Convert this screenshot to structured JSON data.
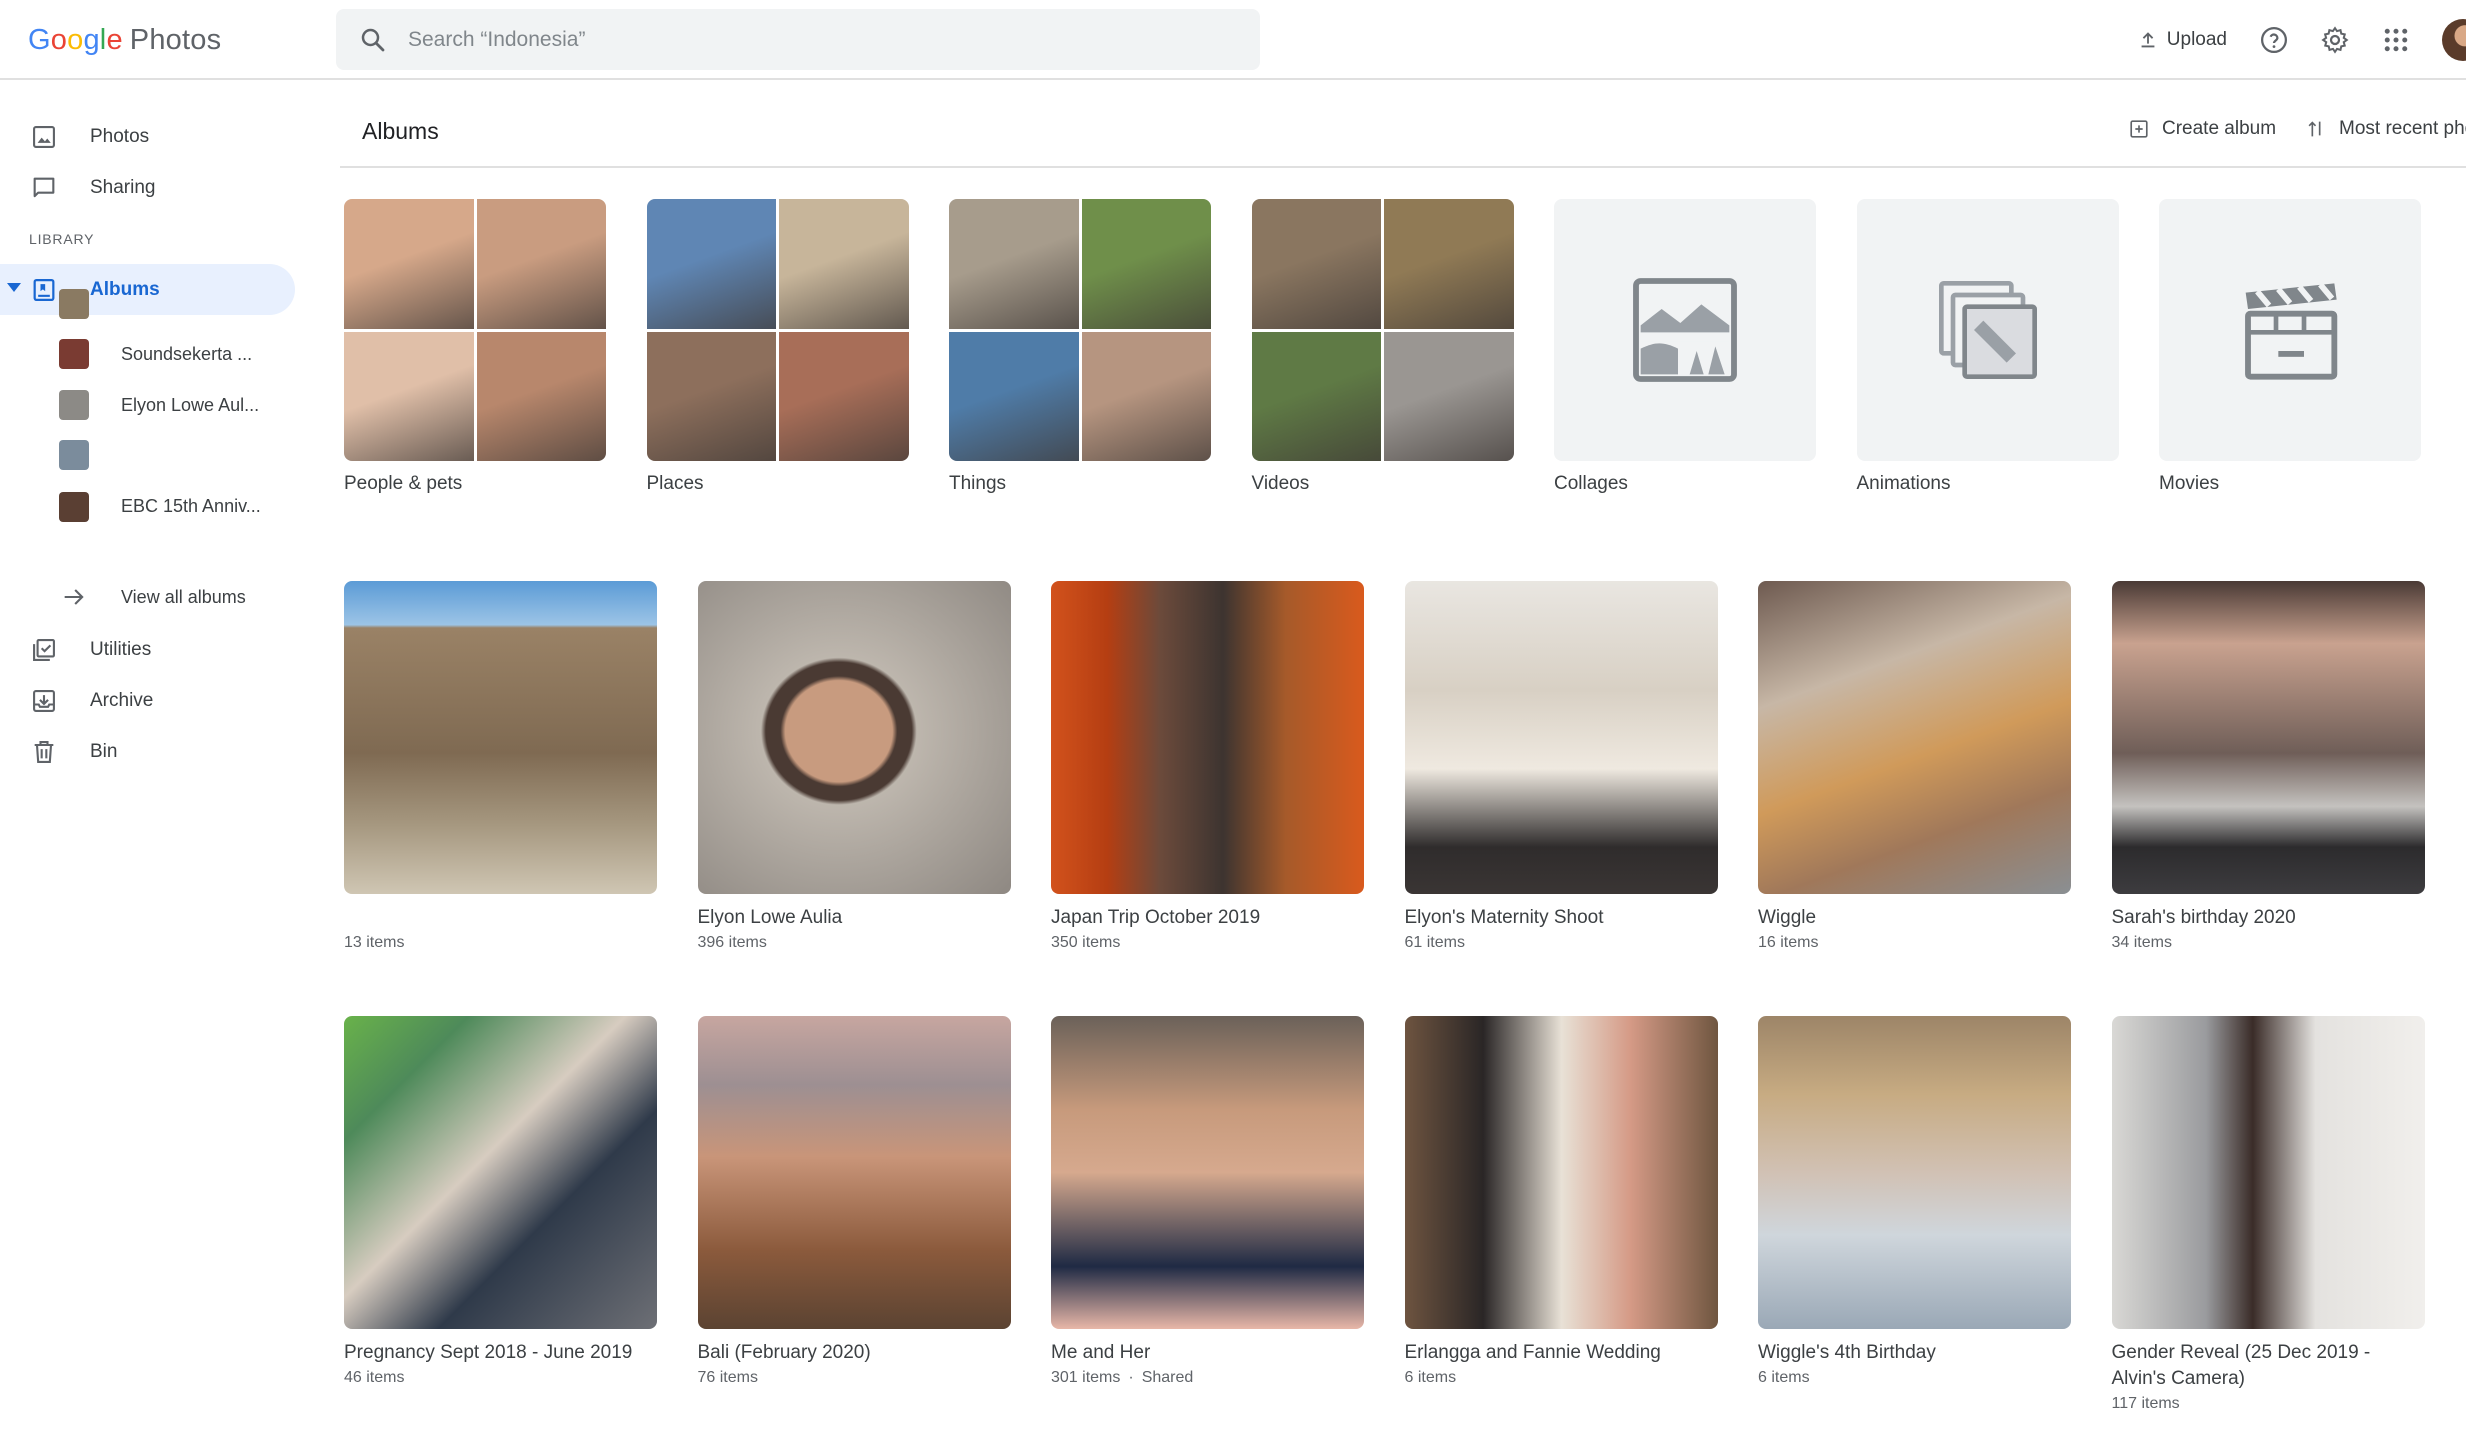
{
  "header": {
    "logo_brand": "Google",
    "logo_product": "Photos",
    "search_placeholder": "Search “Indonesia”",
    "upload_label": "Upload"
  },
  "sidebar": {
    "photos": "Photos",
    "sharing": "Sharing",
    "library_heading": "LIBRARY",
    "albums": "Albums",
    "recent_albums": [
      {
        "label": "",
        "thumb_color": "#8a7a62"
      },
      {
        "label": "Soundsekerta ...",
        "thumb_color": "#7a3b32"
      },
      {
        "label": "Elyon Lowe Aul...",
        "thumb_color": "#8c8a86"
      },
      {
        "label": "",
        "thumb_color": "#7b8c9c"
      },
      {
        "label": "EBC 15th Anniv...",
        "thumb_color": "#5a3f33"
      }
    ],
    "view_all": "View all albums",
    "utilities": "Utilities",
    "archive": "Archive",
    "bin": "Bin"
  },
  "main": {
    "title": "Albums",
    "create_album": "Create album",
    "sort_label": "Most recent pho",
    "categories": [
      {
        "label": "People & pets",
        "colors": [
          "#d6a88a",
          "#c99c80",
          "#e0bfa8",
          "#b8876c"
        ]
      },
      {
        "label": "Places",
        "colors": [
          "#5f86b4",
          "#c7b59a",
          "#8d6f5c",
          "#a86e58"
        ]
      },
      {
        "label": "Things",
        "colors": [
          "#a79c8c",
          "#6f8f4a",
          "#4f7ca8",
          "#b69580"
        ]
      },
      {
        "label": "Videos",
        "colors": [
          "#8a7660",
          "#907a55",
          "#5f7a45",
          "#9a9692"
        ]
      },
      {
        "label": "Collages",
        "icon": "collage-icon"
      },
      {
        "label": "Animations",
        "icon": "animation-icon"
      },
      {
        "label": "Movies",
        "icon": "movie-clapper-icon"
      }
    ],
    "albums": [
      {
        "title": "",
        "count": "13 items",
        "shared": "",
        "bg": "linear-gradient(180deg,#5b9bd6 0%,#9cc4e6 14%,#9a8266 15%,#7f6a52 55%,#a69880 78%,#cfc6b3 100%)"
      },
      {
        "title": "Elyon Lowe Aulia",
        "count": "396 items",
        "shared": "",
        "bg": "radial-gradient(ellipse at 45% 48%,#c89b7f 0 22%,#4a3a33 24% 30%,#bdb6ad 32%,#8e8882 100%)"
      },
      {
        "title": "Japan Trip October 2019",
        "count": "350 items",
        "shared": "",
        "bg": "linear-gradient(90deg,#d2521c 0%,#b53e12 18%,#6b4a3b 35%,#3d3430 55%,#a65a2a 75%,#d95a1d 100%)"
      },
      {
        "title": "Elyon's Maternity Shoot",
        "count": "61 items",
        "shared": "",
        "bg": "linear-gradient(180deg,#e9e6e1 0%,#d8d0c4 35%,#efe9e0 60%,#2f2c2c 85%,#3a3534 100%)"
      },
      {
        "title": "Wiggle",
        "count": "16 items",
        "shared": "",
        "bg": "linear-gradient(160deg,#6e5a50 0%,#c7b7a6 30%,#d09a5a 55%,#a0785a 75%,#8a8f93 100%)"
      },
      {
        "title": "Sarah's birthday 2020",
        "count": "34 items",
        "shared": "",
        "bg": "linear-gradient(180deg,#4a3a35 0%,#c9a28f 20%,#6f5e58 55%,#c4c2bf 72%,#2c2b2d 85%,#3d3c3f 100%)"
      },
      {
        "title": "Pregnancy Sept 2018 - June 2019",
        "count": "46 items",
        "shared": "",
        "bg": "linear-gradient(135deg,#69b24a 0%,#4e8a5a 20%,#d7ccc0 45%,#2f3a4a 65%,#6d6f75 100%)"
      },
      {
        "title": "Bali (February 2020)",
        "count": "76 items",
        "shared": "",
        "bg": "linear-gradient(180deg,#c7a6a0 0%,#9d8f92 22%,#c99579 45%,#8b5a3c 75%,#5b4332 100%)"
      },
      {
        "title": "Me and Her",
        "count": "301 items",
        "shared": "Shared",
        "bg": "linear-gradient(180deg,#6b6159 0%,#c79a7c 30%,#d6a98e 50%,#1f2a44 80%,#e8b7a8 100%)"
      },
      {
        "title": "Erlangga and Fannie Wedding",
        "count": "6 items",
        "shared": "",
        "bg": "linear-gradient(90deg,#6e5440 0%,#2a2626 25%,#e8e1d6 50%,#d59a86 72%,#6f5640 100%)"
      },
      {
        "title": "Wiggle's 4th Birthday",
        "count": "6 items",
        "shared": "",
        "bg": "linear-gradient(180deg,#9d8568 0%,#c7ab82 25%,#d1c1b4 50%,#cfd6dc 70%,#9aa8b6 100%)"
      },
      {
        "title": "Gender Reveal (25 Dec 2019 - Alvin's Camera)",
        "count": "117 items",
        "shared": "",
        "bg": "linear-gradient(90deg,#d9d8d5 0%,#9a9b9e 30%,#3a2c28 45%,#e4e2df 65%,#f1efec 100%)"
      }
    ]
  }
}
